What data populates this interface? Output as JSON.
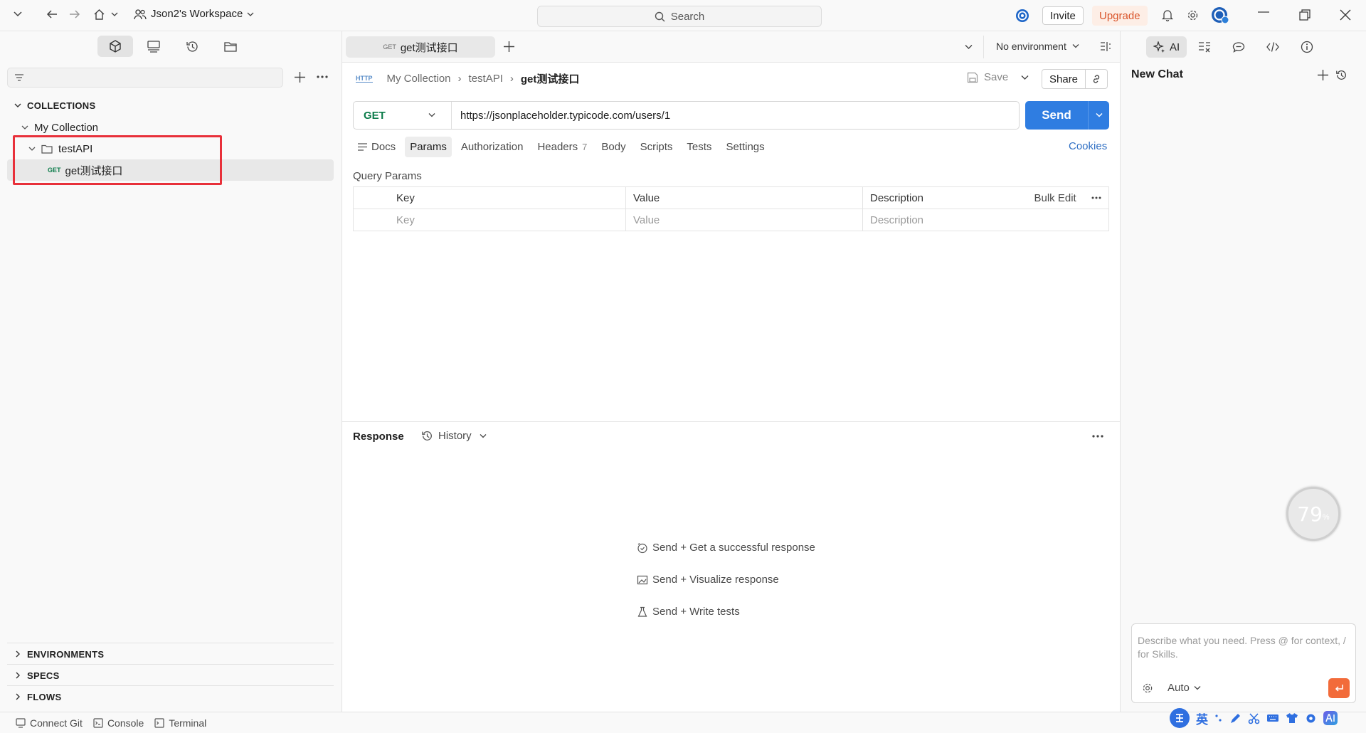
{
  "header": {
    "workspace": "Json2's Workspace",
    "search_placeholder": "Search",
    "invite_label": "Invite",
    "upgrade_label": "Upgrade"
  },
  "sidebar": {
    "section_collections": "COLLECTIONS",
    "collection_name": "My Collection",
    "folder_name": "testAPI",
    "request_method": "GET",
    "request_name": "get测试接口",
    "section_environments": "ENVIRONMENTS",
    "section_specs": "SPECS",
    "section_flows": "FLOWS"
  },
  "tab": {
    "method": "GET",
    "name": "get测试接口",
    "environment": "No environment"
  },
  "breadcrumb": {
    "protocol": "HTTP",
    "collection": "My Collection",
    "folder": "testAPI",
    "request": "get测试接口",
    "save_label": "Save",
    "share_label": "Share"
  },
  "request": {
    "method": "GET",
    "url": "https://jsonplaceholder.typicode.com/users/1",
    "send_label": "Send"
  },
  "subtabs": {
    "docs": "Docs",
    "params": "Params",
    "authorization": "Authorization",
    "headers": "Headers",
    "headers_count": "7",
    "body": "Body",
    "scripts": "Scripts",
    "tests": "Tests",
    "settings": "Settings",
    "cookies": "Cookies"
  },
  "params": {
    "title": "Query Params",
    "col_key": "Key",
    "col_value": "Value",
    "col_description": "Description",
    "bulk_edit": "Bulk Edit",
    "ph_key": "Key",
    "ph_value": "Value",
    "ph_description": "Description"
  },
  "response": {
    "title": "Response",
    "history_label": "History",
    "hint_1": "Send + Get a successful response",
    "hint_2": "Send + Visualize response",
    "hint_3": "Send + Write tests"
  },
  "ai_panel": {
    "ai_tab": "AI",
    "title": "New Chat",
    "input_placeholder": "Describe what you need. Press @ for context, / for Skills.",
    "mode": "Auto",
    "cpu_value": "79",
    "cpu_unit": "%"
  },
  "statusbar": {
    "connect_git": "Connect Git",
    "console": "Console",
    "terminal": "Terminal",
    "ime_label": "英"
  },
  "colors": {
    "accent": "#2f7de1",
    "get_method": "#0d7c4b",
    "highlight_box": "#e8303a",
    "upgrade": "#d9542a"
  }
}
